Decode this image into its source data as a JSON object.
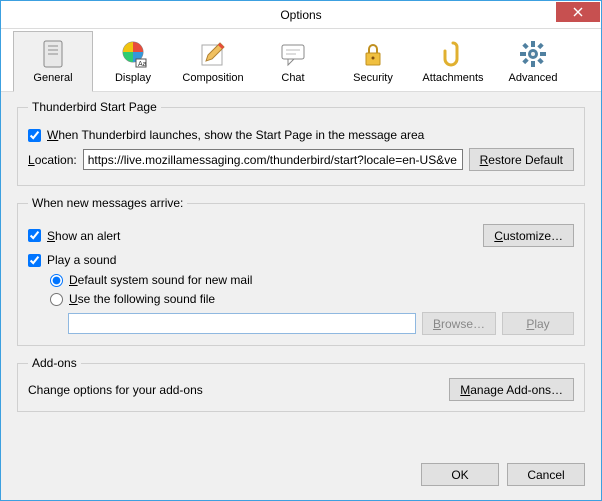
{
  "window": {
    "title": "Options"
  },
  "tabs": {
    "general": "General",
    "display": "Display",
    "composition": "Composition",
    "chat": "Chat",
    "security": "Security",
    "attachments": "Attachments",
    "advanced": "Advanced"
  },
  "startpage": {
    "legend": "Thunderbird Start Page",
    "checkbox_label_pre": "W",
    "checkbox_label_rest": "hen Thunderbird launches, show the Start Page in the message area",
    "location_label_pre": "L",
    "location_label_rest": "ocation:",
    "location_value": "https://live.mozillamessaging.com/thunderbird/start?locale=en-US&ve",
    "restore_pre": "R",
    "restore_rest": "estore Default"
  },
  "messages": {
    "legend": "When new messages arrive:",
    "show_alert_pre": "S",
    "show_alert_rest": "how an alert",
    "customize_pre": "C",
    "customize_post": "ustomize…",
    "play_sound": "Play a sound",
    "default_sound_pre": "D",
    "default_sound_rest": "efault system sound for new mail",
    "use_file_pre": "U",
    "use_file_rest": "se the following sound file",
    "browse_pre": "B",
    "browse_rest": "rowse…",
    "play_pre": "P",
    "play_rest": "lay"
  },
  "addons": {
    "legend": "Add-ons",
    "desc": "Change options for your add-ons",
    "manage_pre": "M",
    "manage_rest": "anage Add-ons…"
  },
  "buttons": {
    "ok": "OK",
    "cancel": "Cancel"
  }
}
